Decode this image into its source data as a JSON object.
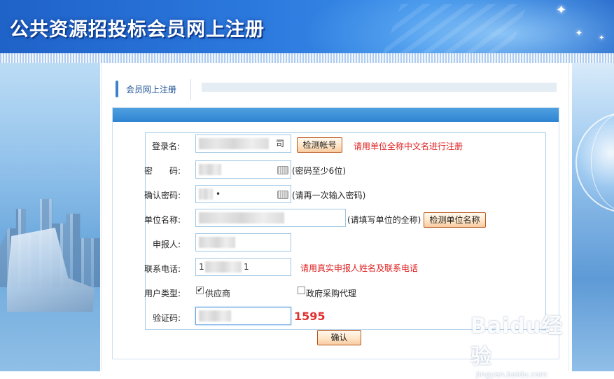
{
  "banner": {
    "title": "公共资源招投标会员网上注册"
  },
  "section": {
    "title": "会员网上注册"
  },
  "form": {
    "login_name": {
      "label": "登录名:",
      "value_tail": "司",
      "check_button": "检测帐号",
      "hint": "请用单位全称中文名进行注册"
    },
    "password": {
      "label": "密　　码:",
      "note": "(密码至少6位)"
    },
    "confirm_password": {
      "label": "确认密码:",
      "value_tail": "•",
      "note": "(请再一次输入密码)"
    },
    "unit_name": {
      "label": "单位名称:",
      "note": "(请填写单位的全称)",
      "check_button": "检测单位名称"
    },
    "applicant": {
      "label": "申报人:"
    },
    "phone": {
      "label": "联系电话:",
      "value_head": "1",
      "value_tail": "1",
      "hint": "请用真实申报人姓名及联系电话"
    },
    "user_type": {
      "label": "用户类型:",
      "option_supplier": "供应商",
      "option_supplier_checked": true,
      "option_agency": "政府采购代理",
      "option_agency_checked": false
    },
    "captcha": {
      "label": "验证码:",
      "code": "1595"
    },
    "submit_button": "确认"
  },
  "watermark": {
    "brand": "Baidu经验",
    "url": "jingyan.baidu.com"
  }
}
